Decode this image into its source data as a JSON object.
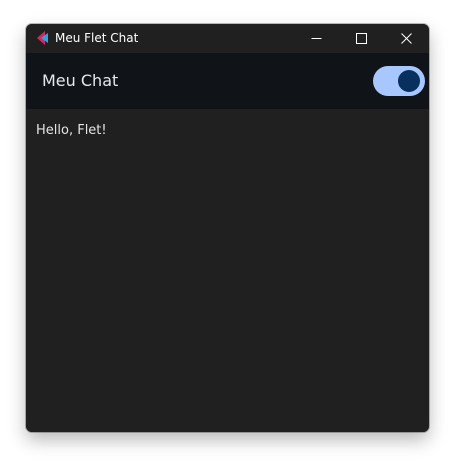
{
  "window": {
    "title": "Meu Flet Chat",
    "controls": {
      "minimize_icon": "minimize-icon",
      "maximize_icon": "maximize-icon",
      "close_icon": "close-icon"
    }
  },
  "appbar": {
    "title": "Meu Chat",
    "theme_icon": "moon-icon",
    "theme_toggle": {
      "on": true,
      "track_color": "#a9c7ff",
      "thumb_color": "#07305f"
    }
  },
  "content": {
    "message": "Hello, Flet!"
  },
  "colors": {
    "window_background": "#202020",
    "appbar_background": "#101418",
    "text_primary": "#e4e4e4"
  }
}
